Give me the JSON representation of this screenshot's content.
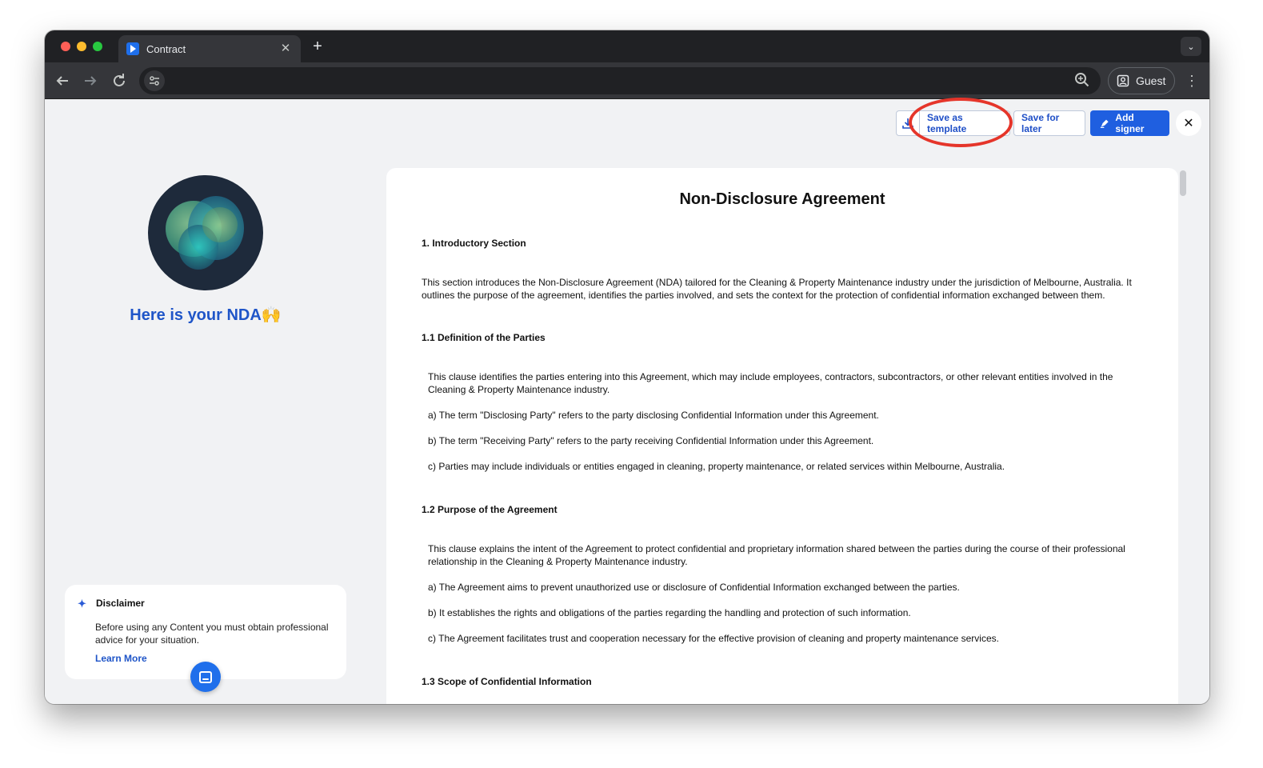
{
  "browser": {
    "tab_title": "Contract",
    "tab_close": "✕",
    "new_tab": "+",
    "tab_menu": "⌄",
    "profile_label": "Guest",
    "omnibox_value": ""
  },
  "actions": {
    "save_template_label": "Save as template",
    "save_later_label": "Save for later",
    "add_signer_label": "Add signer",
    "close_label": "✕"
  },
  "left": {
    "ready_title": "Here is your NDA🙌",
    "disclaimer_title": "Disclaimer",
    "disclaimer_body": "Before using any Content you must obtain professional advice for your situation.",
    "learn_more": "Learn More"
  },
  "document": {
    "title": "Non-Disclosure Agreement",
    "s1_heading": "1. Introductory Section",
    "s1_body": "This section introduces the Non-Disclosure Agreement (NDA) tailored for the Cleaning & Property Maintenance industry under the jurisdiction of Melbourne, Australia. It outlines the purpose of the agreement, identifies the parties involved, and sets the context for the protection of confidential information exchanged between them.",
    "s11_heading": "1.1 Definition of the Parties",
    "s11_body": "This clause identifies the parties entering into this Agreement, which may include employees, contractors, subcontractors, or other relevant entities involved in the Cleaning & Property Maintenance industry.",
    "s11_a": "a) The term \"Disclosing Party\" refers to the party disclosing Confidential Information under this Agreement.",
    "s11_b": "b) The term \"Receiving Party\" refers to the party receiving Confidential Information under this Agreement.",
    "s11_c": "c) Parties may include individuals or entities engaged in cleaning, property maintenance, or related services within Melbourne, Australia.",
    "s12_heading": "1.2 Purpose of the Agreement",
    "s12_body": "This clause explains the intent of the Agreement to protect confidential and proprietary information shared between the parties during the course of their professional relationship in the Cleaning & Property Maintenance industry.",
    "s12_a": "a) The Agreement aims to prevent unauthorized use or disclosure of Confidential Information exchanged between the parties.",
    "s12_b": "b) It establishes the rights and obligations of the parties regarding the handling and protection of such information.",
    "s12_c": "c) The Agreement facilitates trust and cooperation necessary for the effective provision of cleaning and property maintenance services.",
    "s13_heading": "1.3 Scope of Confidential Information"
  }
}
